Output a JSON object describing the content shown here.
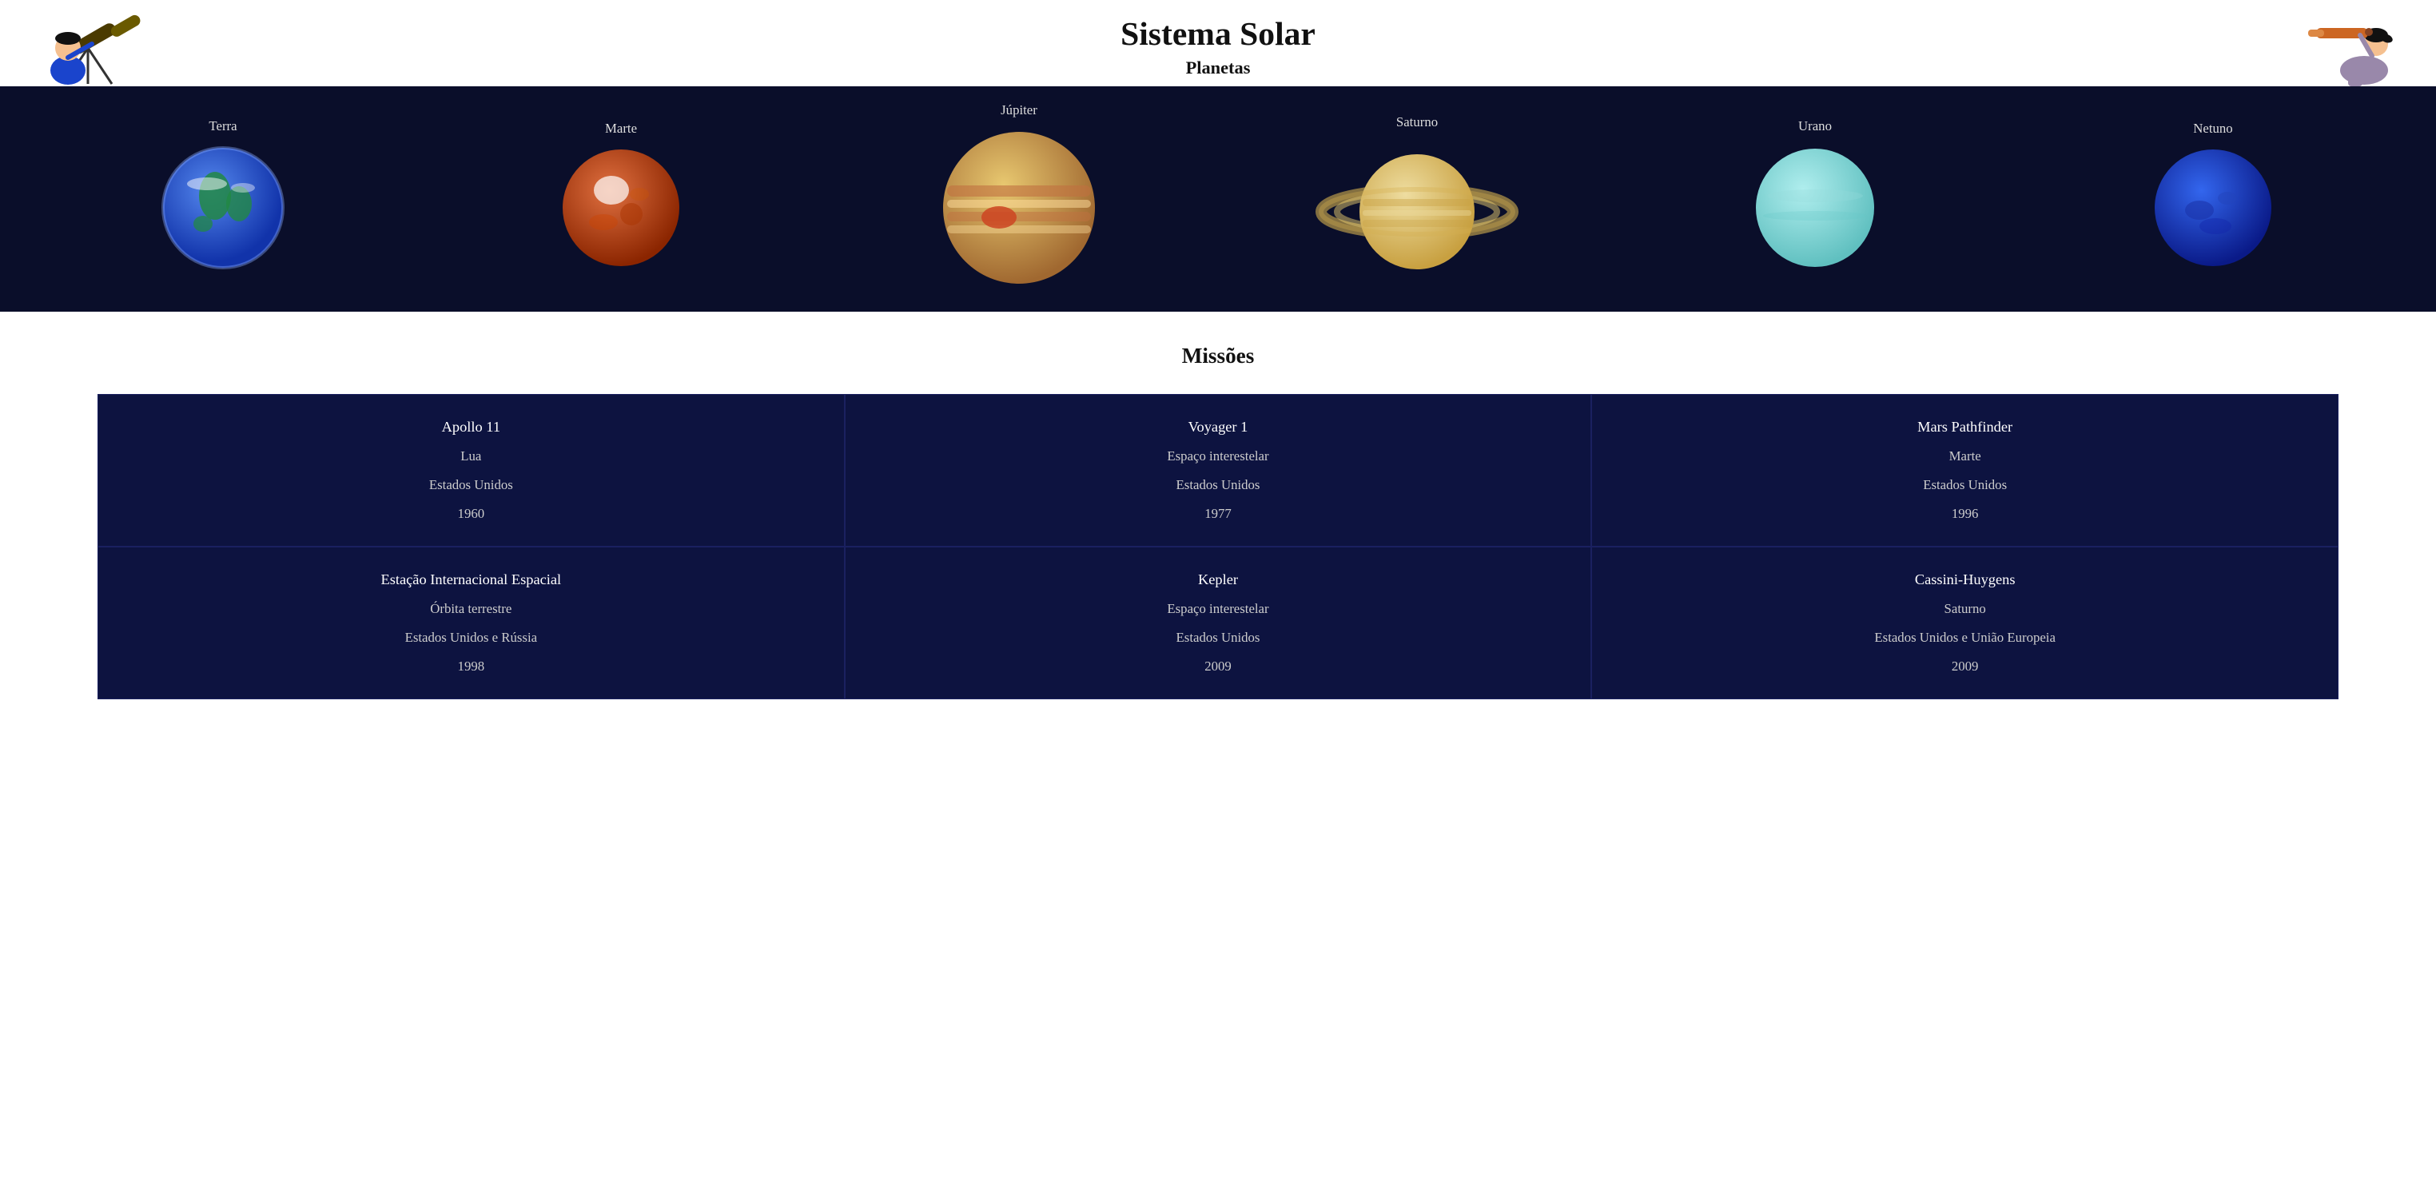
{
  "header": {
    "title": "Sistema Solar",
    "subtitle": "Planetas"
  },
  "planets": [
    {
      "name": "Terra",
      "color": "#2255cc",
      "color2": "#44aaee",
      "size": 160,
      "type": "earth"
    },
    {
      "name": "Marte",
      "color": "#c84a10",
      "color2": "#e06020",
      "size": 155,
      "type": "mars"
    },
    {
      "name": "Júpiter",
      "color": "#c8a060",
      "color2": "#e0b870",
      "size": 200,
      "type": "jupiter"
    },
    {
      "name": "Saturno",
      "color": "#d4b870",
      "color2": "#e8d090",
      "size": 170,
      "type": "saturn"
    },
    {
      "name": "Urano",
      "color": "#80d8d8",
      "color2": "#a0eee8",
      "size": 160,
      "type": "uranus"
    },
    {
      "name": "Netuno",
      "color": "#1a40cc",
      "color2": "#2255ee",
      "size": 155,
      "type": "neptune"
    }
  ],
  "missions_section": {
    "title": "Missões"
  },
  "missions": [
    {
      "name": "Apollo 11",
      "destination": "Lua",
      "country": "Estados Unidos",
      "year": "1960"
    },
    {
      "name": "Voyager 1",
      "destination": "Espaço interestelar",
      "country": "Estados Unidos",
      "year": "1977"
    },
    {
      "name": "Mars Pathfinder",
      "destination": "Marte",
      "country": "Estados Unidos",
      "year": "1996"
    },
    {
      "name": "Estação Internacional Espacial",
      "destination": "Órbita terrestre",
      "country": "Estados Unidos e Rússia",
      "year": "1998"
    },
    {
      "name": "Kepler",
      "destination": "Espaço interestelar",
      "country": "Estados Unidos",
      "year": "2009"
    },
    {
      "name": "Cassini-Huygens",
      "destination": "Saturno",
      "country": "Estados Unidos e União Europeia",
      "year": "2009"
    }
  ]
}
